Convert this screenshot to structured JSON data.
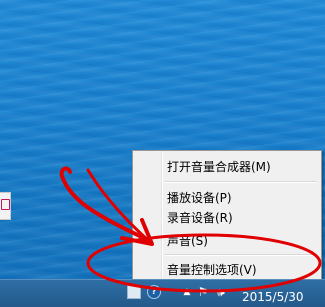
{
  "context_menu": {
    "items": [
      {
        "label": "打开音量合成器(M)"
      },
      {
        "label": "播放设备(P)"
      },
      {
        "label": "录音设备(R)"
      },
      {
        "label": "声音(S)"
      },
      {
        "label": "音量控制选项(V)"
      }
    ]
  },
  "taskbar": {
    "clock": "2015/5/30",
    "tray_icons": [
      "network-icon",
      "help-icon",
      "show-hidden-icons-icon",
      "action-center-flag-icon",
      "volume-icon"
    ]
  },
  "colors": {
    "desktop": "#1a82cf",
    "menu_background": "#f0f0f0",
    "annotation_red": "#e00000",
    "taskbar": "#2a6599"
  }
}
